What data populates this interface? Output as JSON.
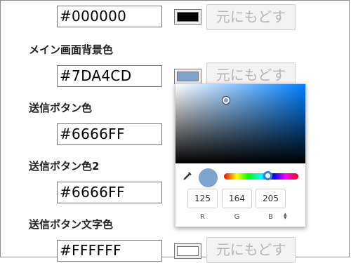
{
  "rows": [
    {
      "label": "",
      "hex": "#000000",
      "swatch": "#000000",
      "reset": "元にもどす"
    },
    {
      "label": "メイン画面背景色",
      "hex": "#7DA4CD",
      "swatch": "#7DA4CD",
      "reset": "元にもどす"
    },
    {
      "label": "送信ボタン色",
      "hex": "#6666FF"
    },
    {
      "label": "送信ボタン色2",
      "hex": "#6666FF"
    },
    {
      "label": "送信ボタン文字色",
      "hex": "#FFFFFF",
      "swatch": "#FFFFFF",
      "reset": "元にもどす"
    }
  ],
  "picker": {
    "color": "#7DA4CD",
    "hue_fraction": 0.59,
    "saturation": 0.39,
    "value": 0.8,
    "channels": [
      {
        "value": "125",
        "label": "R"
      },
      {
        "value": "164",
        "label": "G"
      },
      {
        "value": "205",
        "label": "B"
      }
    ],
    "icons": [
      "eyedropper-icon",
      "stepper-arrows-icon"
    ]
  }
}
